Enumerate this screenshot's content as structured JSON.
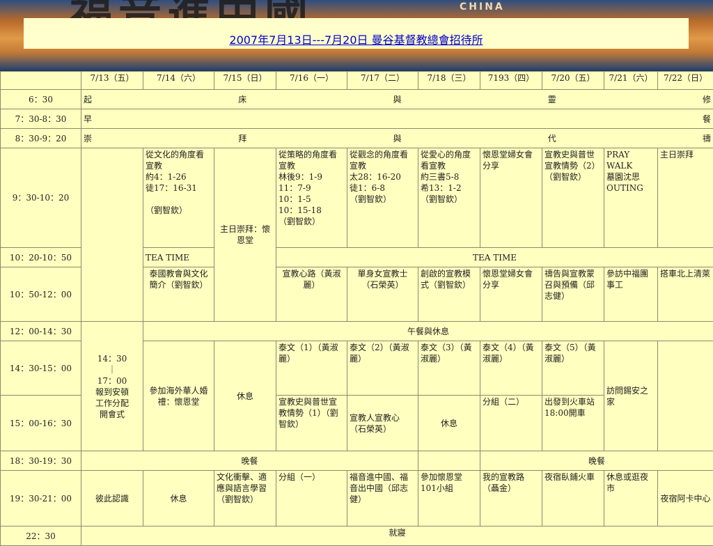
{
  "banner": {
    "art_text": "福音進中國",
    "word": "CHINA"
  },
  "title": "2007年7月13日---7月20日 曼谷基督教總會招待所",
  "header": [
    "7/13（五）",
    "7/14（六）",
    "7/15（日）",
    "7/16（一）",
    "7/17（二）",
    "7/18（三）",
    "7193（四）",
    "7/20（五）",
    "7/21（六）",
    "7/22（日）"
  ],
  "times": {
    "t1": "6：30",
    "t2": "7：30-8：30",
    "t3": "8：30-9：20",
    "t4": "9：30-10：20",
    "t5": "10：20-10：50",
    "t6": "10：50-12：00",
    "t7": "12：00-14：30",
    "t8": "14：30-15：00",
    "t9": "15：00-16：30",
    "t10": "18：30-19：30",
    "t11": "19：30-21：00",
    "t12": "22：30"
  },
  "row1": [
    "起",
    "床",
    "與",
    "靈",
    "修"
  ],
  "row2": [
    "早",
    "餐"
  ],
  "row3": [
    "崇",
    "拜",
    "與",
    "代",
    "禱"
  ],
  "morning": {
    "c714": "從文化的角度看宣教\n約4：1-26\n徒17：16-31\n\n（劉智欽）",
    "c715": "主日崇拜：懷恩堂",
    "c716": "從策略的角度看宣教\n林後9：1-9\n11：7-9\n10：1-5\n10：15-18\n（劉智欽）",
    "c717": "從觀念的角度看宣教\n太28：16-20\n徒1：6-8\n（劉智欽）",
    "c718": "從愛心的角度看宣教\n約三書5-8\n希13：1-2\n（劉智欽）",
    "c719": "懷恩堂婦女會分享",
    "c720": "宣教史與普世宣教情勢（2）（劉智欽）",
    "c721": "PRAY WALK\n墓園沈思\nOUTING",
    "c722": "主日崇拜"
  },
  "tea": {
    "left": "TEA TIME",
    "right": "TEA  TIME"
  },
  "late": {
    "c714": "泰國教會與文化簡介（劉智欽）",
    "c716": "宣教心路（黃淑麗）",
    "c717": "單身女宣教士（石榮英）",
    "c718": "創啟的宣教模式（劉智欽）",
    "c719": "懷恩堂婦女會分享",
    "c720": "禱告與宣教蒙召與預備（邱志健）",
    "c721": "參訪中福團事工",
    "c722": "搭車北上清萊"
  },
  "lunch": "午餐與休息",
  "c713_afternoon": "14：30\n｜\n17：00\n報到安頓\n工作分配\n開會式",
  "afternoon": {
    "c714": "參加海外華人婚禮：懷恩堂",
    "c715": "休息",
    "c716a": "泰文（1）（黃淑麗）",
    "c717a": "泰文（2）（黃淑麗）",
    "c718a": "泰文（3）（黃淑麗）",
    "c719a": "泰文（4）（黃淑麗）",
    "c720a": "泰文（5）（黃淑麗）",
    "c721": "訪問錫安之家",
    "c716b": "宣教史與普世宣教情勢（1）（劉智欽）",
    "c717b": "宣教人宣教心（石榮英）",
    "c718b": "休息",
    "c719b": "分組（二）",
    "c720b": "出發到火車站18:00開車"
  },
  "dinner": {
    "left": "晚餐",
    "right": "晚餐"
  },
  "evening": {
    "c713": "彼此認識",
    "c714": "休息",
    "c715": "文化衝擊、適應與語言學習（劉智欽）",
    "c716": "分組（一）",
    "c717": "福音進中國、福音出中國（邱志健）",
    "c718": "參加懷恩堂101小組",
    "c719": "我的宣教路（聶金）",
    "c720": "夜宿臥鋪火車",
    "c721": "休息或逛夜市",
    "c722": "夜宿阿卡中心"
  },
  "sleep": "就寢"
}
